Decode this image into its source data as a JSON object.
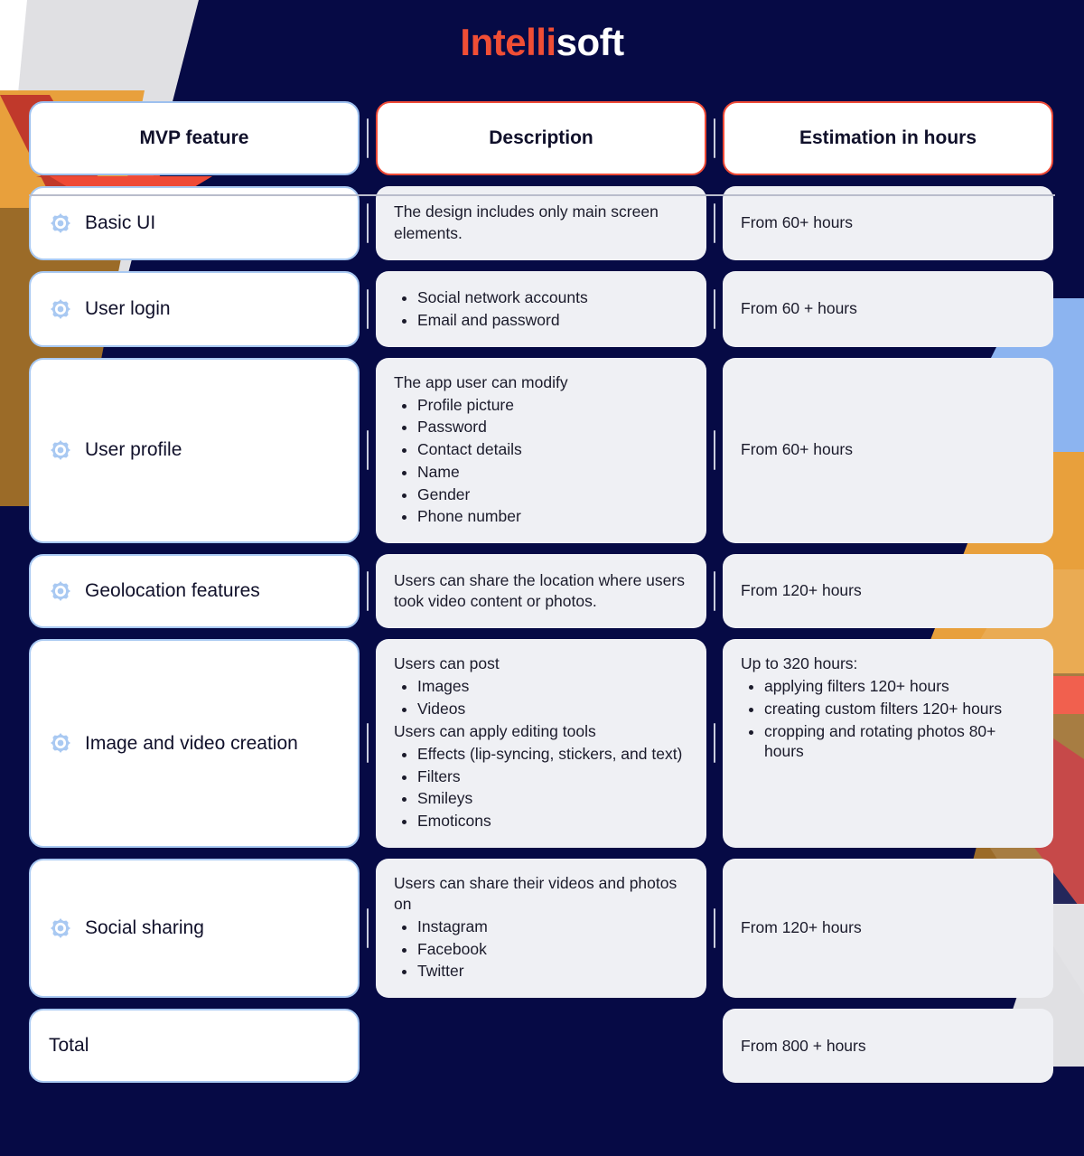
{
  "brand": {
    "part1": "Intelli",
    "part2": "soft"
  },
  "colors": {
    "background": "#060a45",
    "accent_red": "#f04e35",
    "accent_blue": "#a9c9f2",
    "card_grey": "#eff0f4",
    "deco_gray": "#e0e0e3",
    "deco_orange": "#e8a03c",
    "deco_brown": "#9b6b28",
    "deco_dark_red": "#bf3030",
    "deco_light_blue": "#8cb4f0"
  },
  "table": {
    "headers": {
      "feature": "MVP feature",
      "description": "Description",
      "estimation": "Estimation in hours"
    },
    "rows": [
      {
        "feature": "Basic UI",
        "icon": "gear-icon",
        "description": {
          "lead": "The design includes only main screen elements.",
          "items": []
        },
        "estimation": {
          "lead": "From 60+ hours",
          "items": []
        }
      },
      {
        "feature": "User login",
        "icon": "gear-icon",
        "description": {
          "lead": "",
          "items": [
            "Social network accounts",
            "Email and password"
          ]
        },
        "estimation": {
          "lead": "From 60 + hours",
          "items": []
        }
      },
      {
        "feature": "User profile",
        "icon": "gear-icon",
        "description": {
          "lead": "The app user can modify",
          "items": [
            "Profile picture",
            "Password",
            "Contact details",
            "Name",
            "Gender",
            "Phone number"
          ]
        },
        "estimation": {
          "lead": "From 60+ hours",
          "items": []
        }
      },
      {
        "feature": "Geolocation features",
        "icon": "gear-icon",
        "description": {
          "lead": "Users can share the location where users took video content or photos.",
          "items": []
        },
        "estimation": {
          "lead": "From 120+ hours",
          "items": []
        }
      },
      {
        "feature": "Image and video creation",
        "icon": "gear-icon",
        "description": {
          "lead": "Users can post",
          "items": [
            "Images",
            "Videos"
          ],
          "lead2": "Users can apply editing tools",
          "items2": [
            "Effects (lip-syncing, stickers, and text)",
            "Filters",
            "Smileys",
            "Emoticons"
          ]
        },
        "estimation": {
          "lead": "Up to 320 hours:",
          "items": [
            "applying filters 120+ hours",
            "creating custom filters 120+ hours",
            "cropping and rotating photos 80+ hours"
          ]
        }
      },
      {
        "feature": "Social sharing",
        "icon": "gear-icon",
        "description": {
          "lead": "Users can share their videos and photos on",
          "items": [
            "Instagram",
            "Facebook",
            "Twitter"
          ]
        },
        "estimation": {
          "lead": "From 120+ hours",
          "items": []
        }
      }
    ],
    "total": {
      "feature": "Total",
      "estimation": "From 800 + hours"
    }
  }
}
